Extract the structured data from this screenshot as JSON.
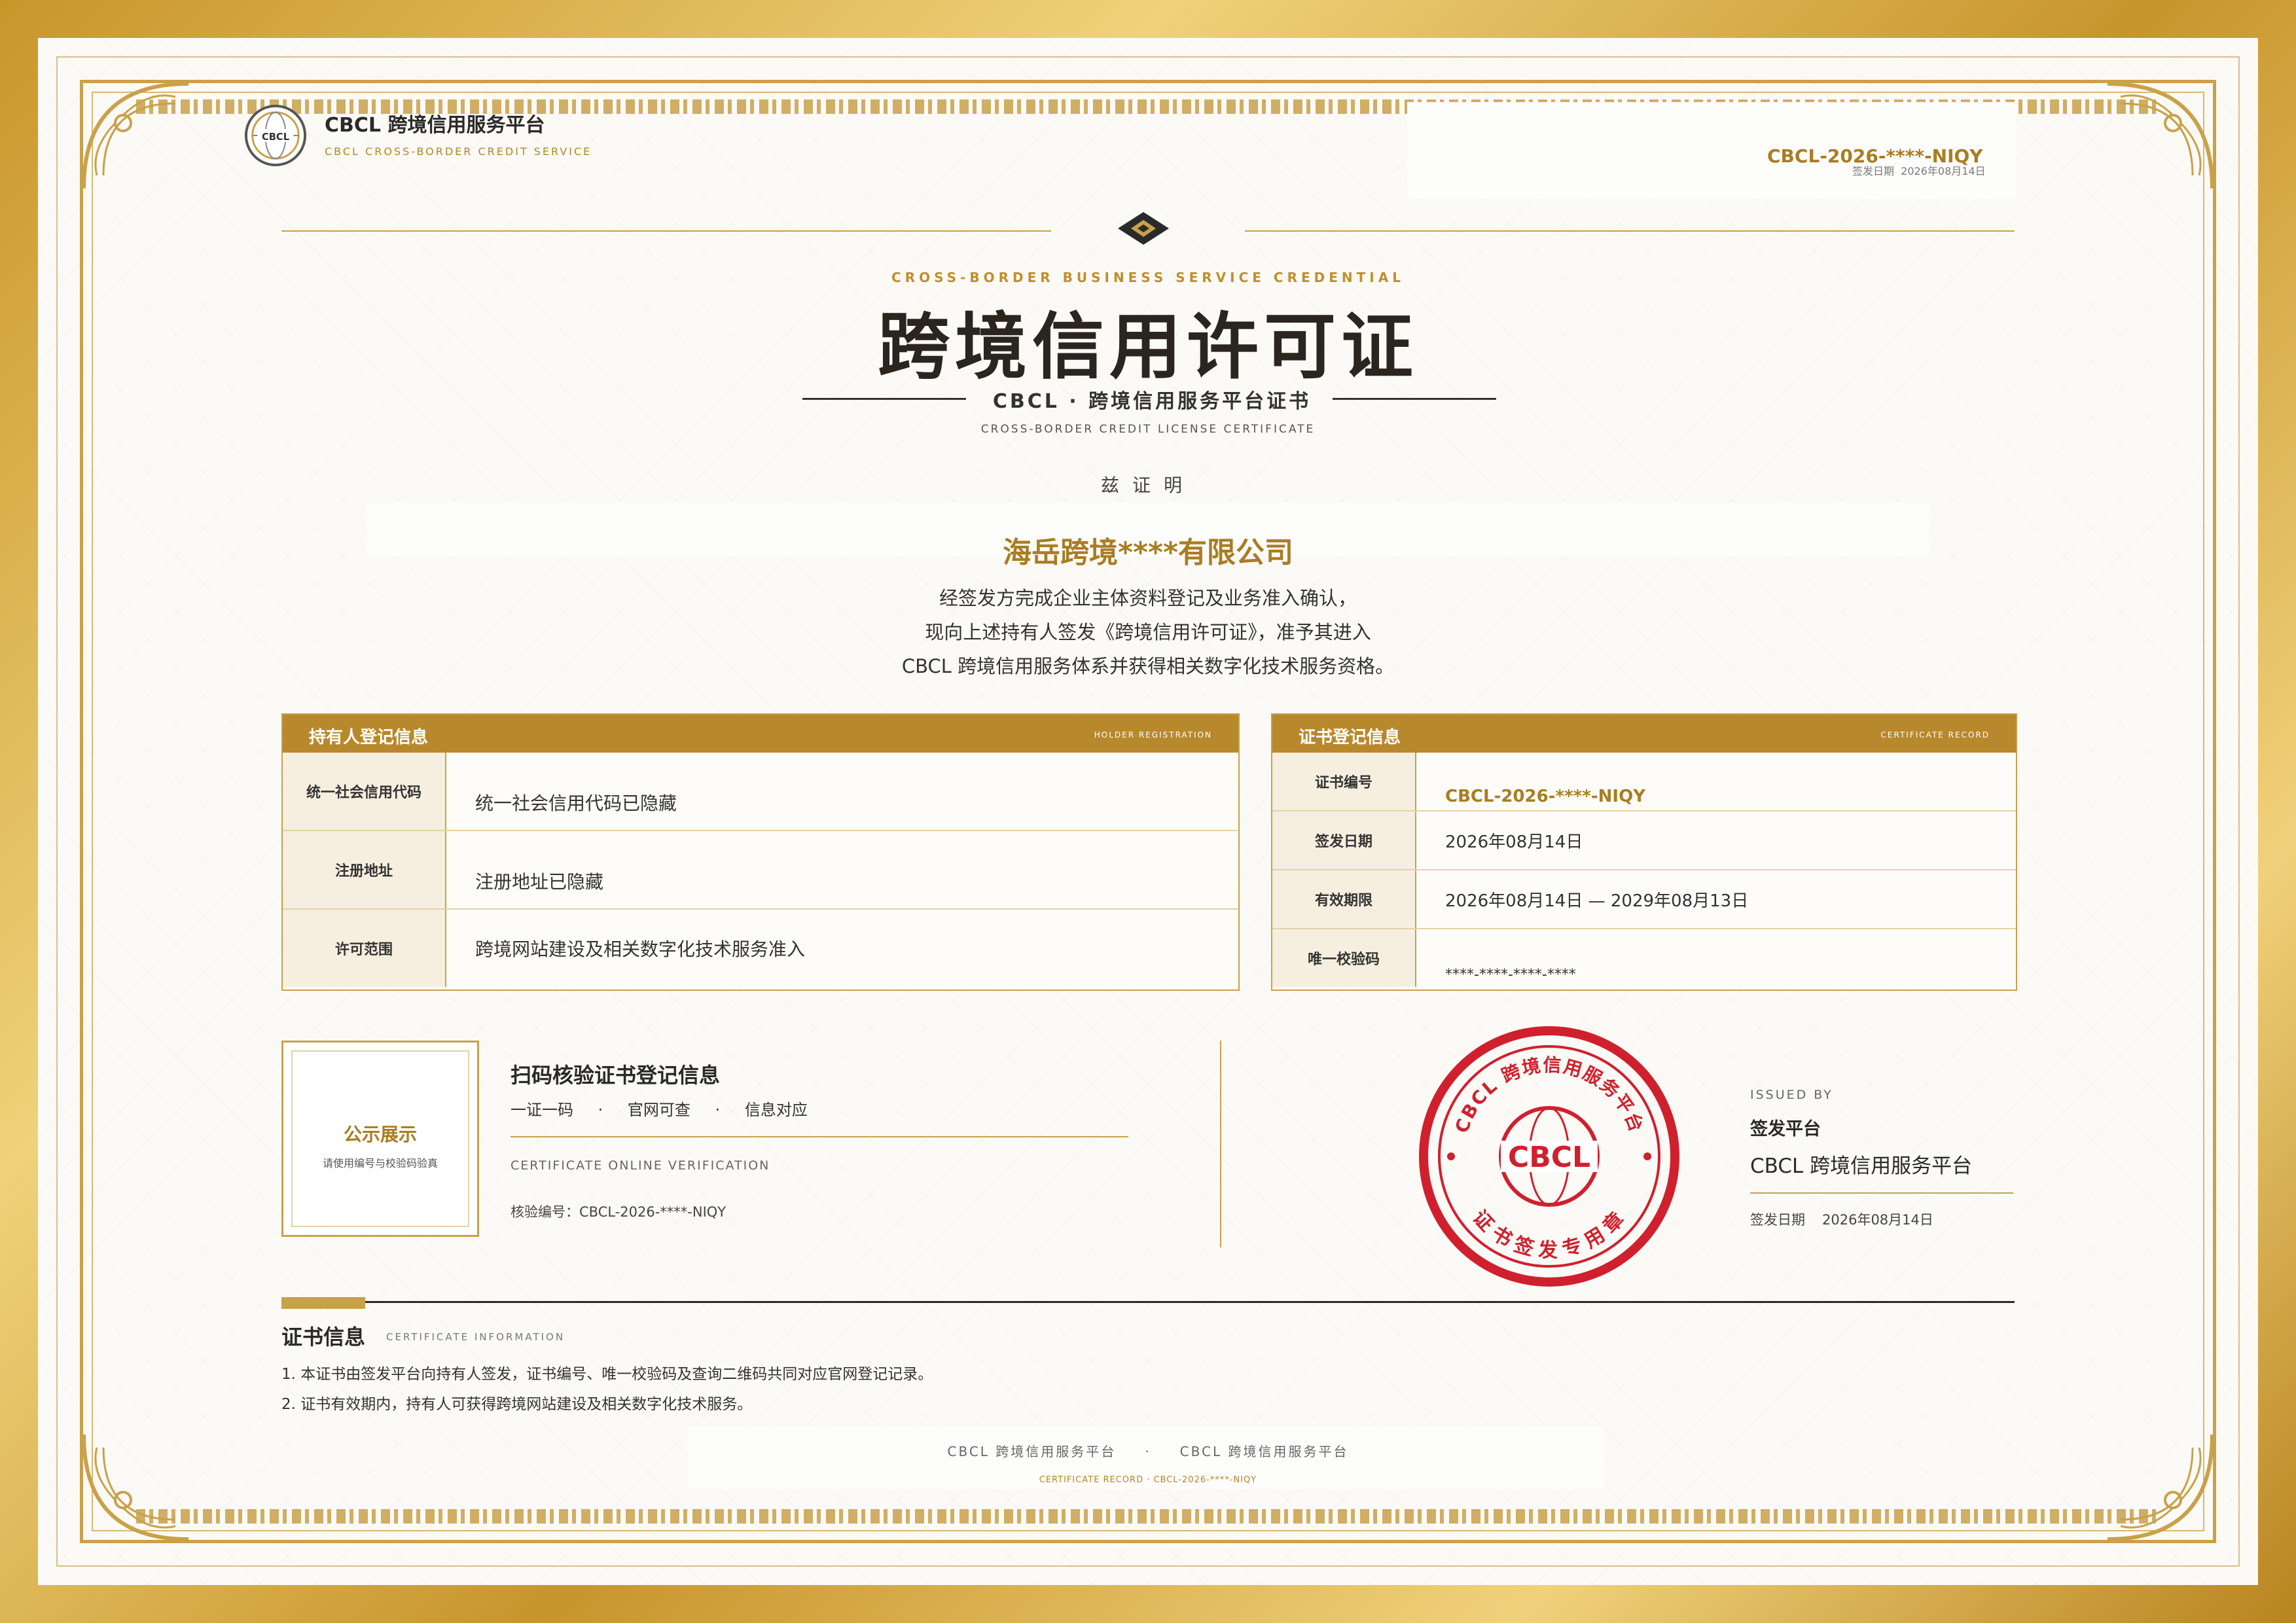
{
  "header": {
    "logo_text": "CBCL",
    "brand_name": "CBCL 跨境信用服务平台",
    "brand_sub": "CBCL CROSS-BORDER CREDIT SERVICE",
    "cert_no": "CBCL-2026-****-NIQY",
    "date_label": "签发日期",
    "date": "2026年08月14日"
  },
  "title": {
    "en_top": "CROSS-BORDER BUSINESS SERVICE CREDENTIAL",
    "main": "跨境信用许可证",
    "subtitle": "CBCL · 跨境信用服务平台证书",
    "en_sub": "CROSS-BORDER CREDIT LICENSE CERTIFICATE",
    "hereby": "兹证明"
  },
  "holder": {
    "name": "海岳跨境****有限公司",
    "body_lines": [
      "经签发方完成企业主体资料登记及业务准入确认，",
      "现向上述持有人签发《跨境信用许可证》，准予其进入",
      "CBCL 跨境信用服务体系并获得相关数字化技术服务资格。"
    ]
  },
  "holder_table": {
    "title": "持有人登记信息",
    "title_en": "HOLDER REGISTRATION",
    "rows": [
      {
        "key": "统一社会信用代码",
        "value": "统一社会信用代码已隐藏"
      },
      {
        "key": "注册地址",
        "value": "注册地址已隐藏"
      },
      {
        "key": "许可范围",
        "value": "跨境网站建设及相关数字化技术服务准入"
      }
    ]
  },
  "cert_table": {
    "title": "证书登记信息",
    "title_en": "CERTIFICATE RECORD",
    "rows": [
      {
        "key": "证书编号",
        "value": "CBCL-2026-****-NIQY"
      },
      {
        "key": "签发日期",
        "value": "2026年08月14日"
      },
      {
        "key": "有效期限",
        "value": "2026年08月14日 — 2029年08月13日"
      },
      {
        "key": "唯一校验码",
        "value": "****-****-****-****"
      }
    ]
  },
  "verify": {
    "qr_title": "公示展示",
    "qr_sub": "请使用编号与校验码验真",
    "title": "扫码核验证书登记信息",
    "tags": [
      "一证一码",
      "·",
      "官网可查",
      "·",
      "信息对应"
    ],
    "en": "CERTIFICATE ONLINE VERIFICATION",
    "no": "核验编号：CBCL-2026-****-NIQY"
  },
  "seal": {
    "top_text": "CBCL 跨境信用服务平台",
    "center": "CBCL",
    "bottom_text": "证书签发专用章",
    "color": "#d0202e"
  },
  "issuer": {
    "en": "ISSUED BY",
    "label": "签发平台",
    "name": "CBCL 跨境信用服务平台",
    "date_label": "签发日期",
    "date": "2026年08月14日"
  },
  "info": {
    "title": "证书信息",
    "title_en": "CERTIFICATE INFORMATION",
    "lines": [
      "1.  本证书由签发平台向持有人签发，证书编号、唯一校验码及查询二维码共同对应官网登记记录。",
      "2.  证书有效期内，持有人可获得跨境网站建设及相关数字化技术服务。"
    ]
  },
  "footer": {
    "left": "CBCL 跨境信用服务平台",
    "sep": "·",
    "right": "CBCL 跨境信用服务平台",
    "small": "CERTIFICATE RECORD · CBCL-2026-****-NIQY"
  },
  "colors": {
    "gold": "#c9a14a",
    "gold_dark": "#a97d23",
    "seal_red": "#d0202e"
  }
}
